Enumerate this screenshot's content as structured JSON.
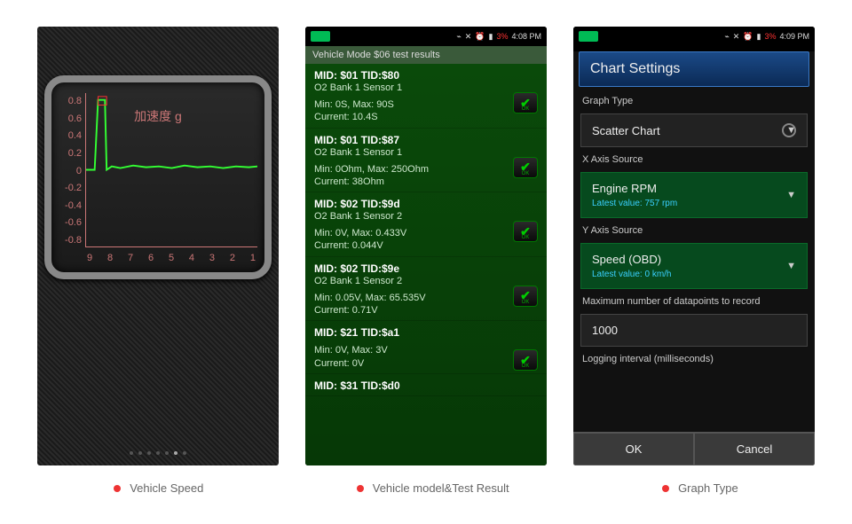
{
  "status": {
    "battery": "3%",
    "time1": "4:08 PM",
    "time2": "4:08 PM",
    "time3": "4:09 PM"
  },
  "phone1": {
    "title": "加速度 g",
    "y_ticks": [
      "0.8",
      "0.6",
      "0.4",
      "0.2",
      "0",
      "-0.2",
      "-0.4",
      "-0.6",
      "-0.8"
    ],
    "x_ticks": [
      "9",
      "8",
      "7",
      "6",
      "5",
      "4",
      "3",
      "2",
      "1"
    ]
  },
  "chart_data": {
    "type": "line",
    "title": "加速度 g",
    "xlabel": "",
    "ylabel": "g",
    "ylim": [
      -0.9,
      0.9
    ],
    "x": [
      9.0,
      8.6,
      8.3,
      8.2,
      8.1,
      8.0,
      7.8,
      7.5,
      7.0,
      6.5,
      6.0,
      5.5,
      5.0,
      4.5,
      4.0,
      3.5,
      3.0,
      2.5,
      2.0,
      1.5,
      1.0
    ],
    "values": [
      0.0,
      0.0,
      0.85,
      0.85,
      0.85,
      0.0,
      0.03,
      0.05,
      0.02,
      0.04,
      0.03,
      0.05,
      0.02,
      0.04,
      0.03,
      0.05,
      0.04,
      0.03,
      0.04,
      0.03,
      0.04
    ]
  },
  "phone2": {
    "header": "Vehicle Mode $06 test results",
    "items": [
      {
        "mid": "MID: $01 TID:$80",
        "sub": "O2 Bank 1 Sensor 1",
        "vals": "Min: 0S, Max: 90S\nCurrent: 10.4S"
      },
      {
        "mid": "MID: $01 TID:$87",
        "sub": "O2 Bank 1 Sensor 1",
        "vals": "Min: 0Ohm, Max: 250Ohm\nCurrent: 38Ohm"
      },
      {
        "mid": "MID: $02 TID:$9d",
        "sub": "O2 Bank 1 Sensor 2",
        "vals": "Min: 0V, Max: 0.433V\nCurrent: 0.044V"
      },
      {
        "mid": "MID: $02 TID:$9e",
        "sub": "O2 Bank 1 Sensor 2",
        "vals": "Min: 0.05V, Max: 65.535V\nCurrent: 0.71V"
      },
      {
        "mid": "MID: $21 TID:$a1",
        "sub": "",
        "vals": "Min: 0V, Max: 3V\nCurrent: 0V"
      },
      {
        "mid": "MID: $31 TID:$d0",
        "sub": "",
        "vals": ""
      }
    ]
  },
  "phone3": {
    "title": "Chart Settings",
    "sections": {
      "graph_type_label": "Graph Type",
      "graph_type_value": "Scatter Chart",
      "x_label": "X Axis Source",
      "x_value": "Engine RPM",
      "x_latest": "Latest value: 757 rpm",
      "y_label": "Y Axis Source",
      "y_value": "Speed (OBD)",
      "y_latest": "Latest value: 0 km/h",
      "max_label": "Maximum number of datapoints to record",
      "max_value": "1000",
      "interval_label": "Logging interval (milliseconds)"
    },
    "ok": "OK",
    "cancel": "Cancel"
  },
  "captions": {
    "c1": "Vehicle Speed",
    "c2": "Vehicle model&Test Result",
    "c3": "Graph Type"
  }
}
